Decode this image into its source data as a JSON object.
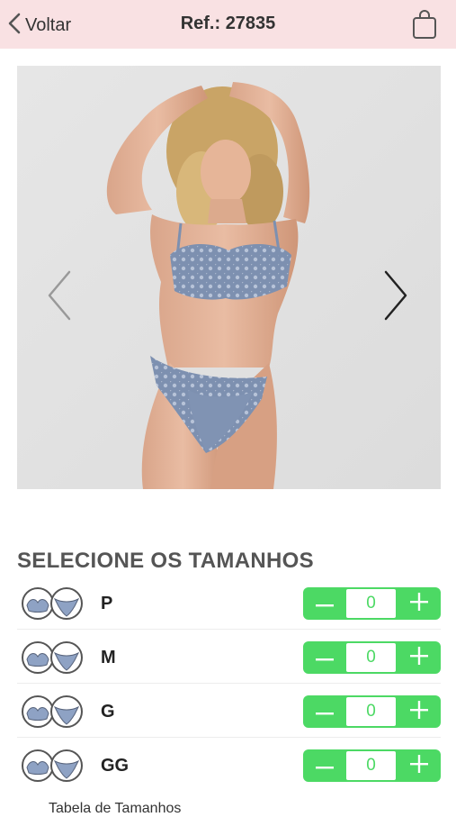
{
  "header": {
    "back_label": "Voltar",
    "title": "Ref.: 27835",
    "icons": {
      "back": "chevron-left-icon",
      "bag": "shopping-bag-icon"
    }
  },
  "gallery": {
    "image": "model-photo",
    "prev_icon": "chevron-left-icon",
    "next_icon": "chevron-right-icon"
  },
  "sizes": {
    "title": "SELECIONE OS TAMANHOS",
    "items": [
      {
        "label": "P",
        "qty": "0"
      },
      {
        "label": "M",
        "qty": "0"
      },
      {
        "label": "G",
        "qty": "0"
      },
      {
        "label": "GG",
        "qty": "0"
      }
    ],
    "stepper": {
      "minus": "−",
      "plus": "+"
    },
    "table_link": "Tabela de Tamanhos"
  },
  "colors": {
    "header_bg": "#f9e1e3",
    "stepper_green": "#4cd964",
    "lingerie_blue": "#7d90b0"
  }
}
